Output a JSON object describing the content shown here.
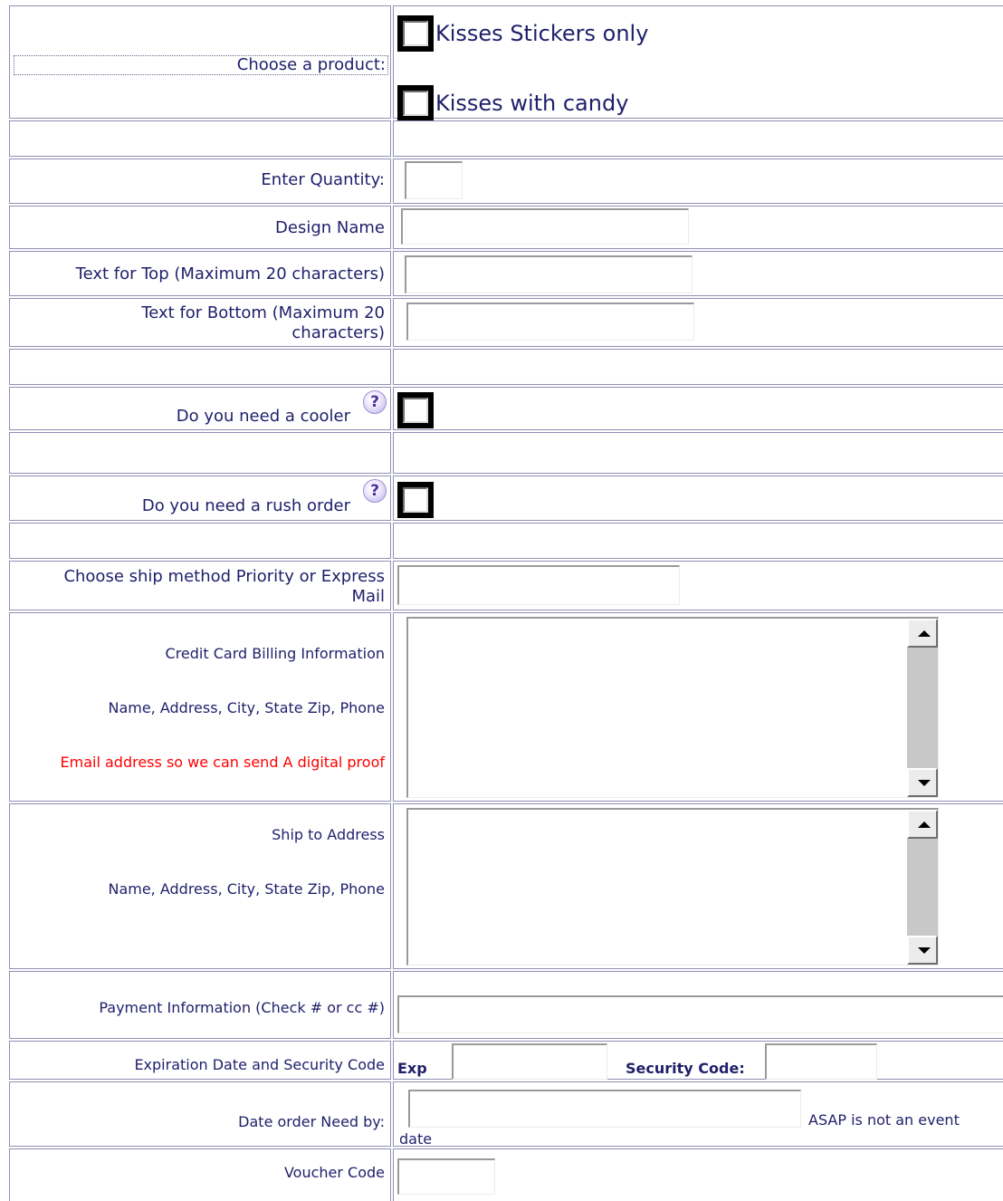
{
  "product": {
    "label": "Choose a product:",
    "options": [
      "Kisses Stickers only",
      "Kisses with candy"
    ]
  },
  "quantity": {
    "label": "Enter Quantity:"
  },
  "design_name": {
    "label": "Design Name"
  },
  "text_top": {
    "label": "Text for Top (Maximum 20 characters)"
  },
  "text_bottom": {
    "label_line1": "Text for Bottom (Maximum 20",
    "label_line2": "characters)"
  },
  "cooler": {
    "label": "Do you need a cooler",
    "help_icon": "question-icon"
  },
  "rush": {
    "label": "Do you need a rush order",
    "help_icon": "question-icon"
  },
  "ship_method": {
    "label_line1": "Choose ship method Priority or Express",
    "label_line2": "Mail"
  },
  "billing": {
    "line1": "Credit Card Billing Information",
    "line2": "Name, Address, City, State Zip, Phone",
    "line3": "Email address so we can send A digital proof"
  },
  "ship_to": {
    "line1": "Ship to Address",
    "line2": "Name, Address, City, State Zip, Phone"
  },
  "payment": {
    "label": "Payment Information (Check # or cc #)"
  },
  "expiration": {
    "label": "Expiration Date and Security Code",
    "exp_label": "Exp",
    "security_label": "Security Code:"
  },
  "need_by": {
    "label": "Date order Need by:",
    "note_line1": "ASAP is not an event",
    "note_line2": "date"
  },
  "voucher": {
    "label": "Voucher Code"
  },
  "colors": {
    "text": "#1f1f6b",
    "warning": "#ff0000",
    "border": "#8f8fb6"
  }
}
